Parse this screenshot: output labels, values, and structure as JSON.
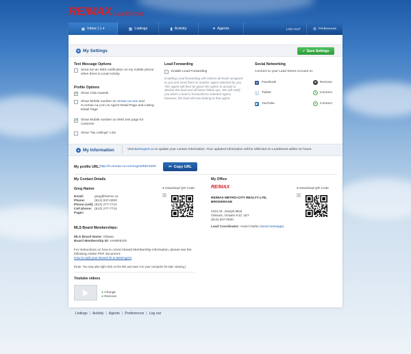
{
  "brand": {
    "name": "RE/MAX",
    "product": "LeadStreet"
  },
  "nav": {
    "inbox": "Inbox (·)",
    "listings": "Listings",
    "activity": "Activity",
    "agents": "Agents",
    "logout": "LOG OUT",
    "preferences": "Preferences"
  },
  "settings": {
    "title": "My Settings",
    "save_label": "Save Settings",
    "text_message": {
      "heading": "Text Message Options",
      "sms_notify": "Send me an SMS notification on my mobile phone when there is Lead Activity",
      "sms_notify_checked": false
    },
    "profile": {
      "heading": "Profile Options",
      "show_club_awards": "Show Club Awards",
      "show_club_awards_checked": true,
      "show_mobile_1": "Show Mobile number on",
      "show_mobile_link": "remax-ca.com",
      "show_mobile_2": " and m.remax-ca.com on Agent Detail Page and Listing Detail Page",
      "show_mobile_checked": false,
      "show_sms": "Show Mobile number on SMS text page for customer",
      "show_sms_checked": true,
      "show_listings": "Show \"My Listings\" Link",
      "show_listings_checked": false
    },
    "lead_forwarding": {
      "heading": "Lead Forwarding",
      "enable": "Enable Lead Forwarding",
      "enable_checked": false,
      "description": "Enabling Lead forwarding will redirect all leads assigned to you and send them to another agent selected by you. This agent will then be given the option to accept or decline the lead and all future follow ups. We will notify you when a lead is forwarded to selected agent; however, the lead will now belong to that agent."
    },
    "social": {
      "heading": "Social Networking",
      "intro": "Connect to your Lead Street Account to:",
      "items": [
        {
          "name": "Facebook",
          "action": "Remove"
        },
        {
          "name": "Twitter",
          "action": "Connect"
        },
        {
          "name": "YouTube",
          "action": "Connect"
        }
      ]
    }
  },
  "info": {
    "title": "My Information",
    "notice_prefix": "Visit ",
    "notice_link": "BestAgent.ca",
    "notice_suffix": " to update your contact information. Your updated information will be reflected on LeadStreet within 24 hours.",
    "profile_url_label": "My profile URL:",
    "profile_url": "http://m.remax-ca.com/Agent/5874200",
    "copy_url": "Copy URL"
  },
  "contact": {
    "heading": "My Contact Details",
    "download_qr": "Download QR Code",
    "name": "Greg Hamre",
    "rows": [
      {
        "label": "Email:",
        "value": "greg@hamre.ca"
      },
      {
        "label": "Phone:",
        "value": "(613) 837-0000"
      },
      {
        "label": "Phone (cell):",
        "value": "(613) 277-7712"
      },
      {
        "label": "Cell phone:",
        "value": "(613) 277-7712"
      },
      {
        "label": "Pager:",
        "value": ""
      }
    ]
  },
  "office": {
    "heading": "My Office",
    "download_qr": "Download QR Code",
    "name": "RE/MAX METRO-CITY REALTY LTD, BROKERAGE",
    "address1": "2315 St. Joseph Blvd",
    "address2": "Orleans, Ontario K1C 1E7",
    "phone": "(613) 837-0000",
    "coordinator_label": "Lead Coordinator:",
    "coordinator_name": "Ansel Clarke",
    "coordinator_link": "(Send message)"
  },
  "mls": {
    "heading": "MLS Board Memberships:",
    "board_label": "MLS Board Name:",
    "board_name": "Ottawa",
    "id_label": "Board Membership ID:",
    "id_value": "HAMREGR",
    "instructions": "For instructions on how to correct Board Membership information, please see the following Adobe PDF document:",
    "instructions_link": "How to add your Board ID to BestAgent",
    "note": "(Note: You may also right click on the link and save it to your computer for later viewing.)"
  },
  "youtube": {
    "heading": "Youtube videos",
    "change": "Change",
    "remove": "Remove"
  },
  "footer": [
    "Listings",
    "Activity",
    "Agents",
    "Preferences",
    "Log out"
  ],
  "colors": {
    "brand_red": "#d2232a",
    "nav_blue": "#1e5aa5",
    "save_green": "#3aa847"
  }
}
